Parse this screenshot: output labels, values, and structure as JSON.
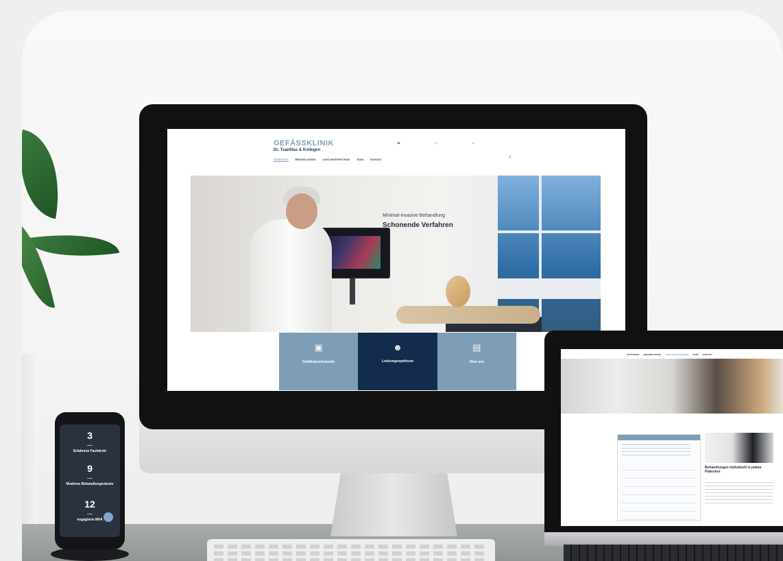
{
  "imac_site": {
    "logo_line1": "GEFÄSSKLINIK",
    "logo_line2": "Dr. Tsantilas & Kollegen",
    "nav": [
      "STARTSEITE",
      "BEHANDLUNGEN",
      "LEISTUNGSSPEKTRUM",
      "TEAM",
      "KONTAKT"
    ],
    "hero_subtitle": "Minimal-invasive Behandlung",
    "hero_title": "Schonende Verfahren",
    "tiles": [
      {
        "title": "Gefäßsprechstunde",
        "color": "#7f9db5",
        "icon": "medical-bag-icon"
      },
      {
        "title": "Leistungsspektrum",
        "color": "#132c4d",
        "icon": "doctor-icon"
      },
      {
        "title": "Über uns",
        "color": "#7f9db5",
        "icon": "clinic-icon"
      }
    ]
  },
  "phone_site": {
    "stats": [
      {
        "number": "3",
        "label": "Erfahrene Fachärzte"
      },
      {
        "number": "9",
        "label": "Moderne Behandlungsräume"
      },
      {
        "number": "12",
        "label": "engagierte MFA"
      }
    ]
  },
  "laptop_site": {
    "nav": [
      "STARTSEITE",
      "BEHANDLUNGEN",
      "LEISTUNGSSPEKTRUM",
      "TEAM",
      "KONTAKT"
    ],
    "title": "Behandlungen individuell in jedem Patienten"
  },
  "colors": {
    "brand_light": "#7f9db5",
    "brand_dark": "#132c4d",
    "background": "#efefef"
  }
}
